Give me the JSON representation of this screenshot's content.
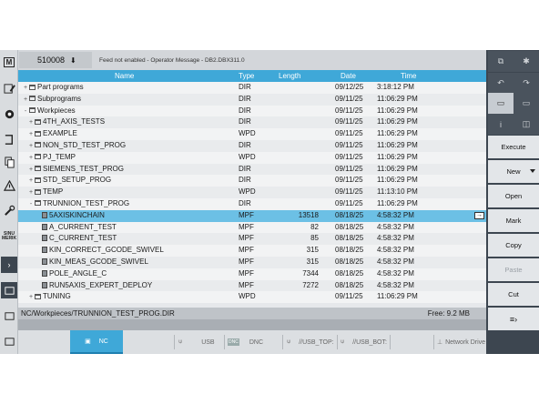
{
  "header": {
    "alarm_number": "510008",
    "alarm_text": "Feed not enabled - Operator Message -  DB2.DBX311.0"
  },
  "columns": {
    "name": "Name",
    "type": "Type",
    "length": "Length",
    "date": "Date",
    "time": "Time"
  },
  "rows": [
    {
      "expander": "+",
      "icon": "folder-icon",
      "name": "Part programs",
      "type": "DIR",
      "length": "",
      "date": "09/12/25",
      "time": "3:18:12 PM"
    },
    {
      "expander": "+",
      "icon": "folder-icon",
      "name": "Subprograms",
      "type": "DIR",
      "length": "",
      "date": "09/11/25",
      "time": "11:06:29 PM"
    },
    {
      "expander": "-",
      "icon": "folder-icon",
      "name": "Workpieces",
      "type": "DIR",
      "length": "",
      "date": "09/11/25",
      "time": "11:06:29 PM"
    },
    {
      "expander": "+",
      "icon": "folder-icon",
      "name": "4TH_AXIS_TESTS",
      "type": "DIR",
      "length": "",
      "date": "09/11/25",
      "time": "11:06:29 PM"
    },
    {
      "expander": "+",
      "icon": "folder-icon",
      "name": "EXAMPLE",
      "type": "WPD",
      "length": "",
      "date": "09/11/25",
      "time": "11:06:29 PM"
    },
    {
      "expander": "+",
      "icon": "folder-icon",
      "name": "NON_STD_TEST_PROG",
      "type": "DIR",
      "length": "",
      "date": "09/11/25",
      "time": "11:06:29 PM"
    },
    {
      "expander": "+",
      "icon": "folder-icon",
      "name": "PJ_TEMP",
      "type": "WPD",
      "length": "",
      "date": "09/11/25",
      "time": "11:06:29 PM"
    },
    {
      "expander": "+",
      "icon": "folder-icon",
      "name": "SIEMENS_TEST_PROG",
      "type": "DIR",
      "length": "",
      "date": "09/11/25",
      "time": "11:06:29 PM"
    },
    {
      "expander": "+",
      "icon": "folder-icon",
      "name": "STD_SETUP_PROG",
      "type": "DIR",
      "length": "",
      "date": "09/11/25",
      "time": "11:06:29 PM"
    },
    {
      "expander": "+",
      "icon": "folder-icon",
      "name": "TEMP",
      "type": "WPD",
      "length": "",
      "date": "09/11/25",
      "time": "11:13:10 PM"
    },
    {
      "expander": "-",
      "icon": "folder-icon",
      "name": "TRUNNION_TEST_PROG",
      "type": "DIR",
      "length": "",
      "date": "09/11/25",
      "time": "11:06:29 PM"
    },
    {
      "expander": "",
      "icon": "file-icon",
      "name": "5AXISKINCHAIN",
      "type": "MPF",
      "length": "13518",
      "date": "08/18/25",
      "time": "4:58:32 PM"
    },
    {
      "expander": "",
      "icon": "file-icon",
      "name": "A_CURRENT_TEST",
      "type": "MPF",
      "length": "82",
      "date": "08/18/25",
      "time": "4:58:32 PM"
    },
    {
      "expander": "",
      "icon": "file-icon",
      "name": "C_CURRENT_TEST",
      "type": "MPF",
      "length": "85",
      "date": "08/18/25",
      "time": "4:58:32 PM"
    },
    {
      "expander": "",
      "icon": "file-icon",
      "name": "KIN_CORRECT_GCODE_SWIVEL",
      "type": "MPF",
      "length": "315",
      "date": "08/18/25",
      "time": "4:58:32 PM"
    },
    {
      "expander": "",
      "icon": "file-icon",
      "name": "KIN_MEAS_GCODE_SWIVEL",
      "type": "MPF",
      "length": "315",
      "date": "08/18/25",
      "time": "4:58:32 PM"
    },
    {
      "expander": "",
      "icon": "file-icon",
      "name": "POLE_ANGLE_C",
      "type": "MPF",
      "length": "7344",
      "date": "08/18/25",
      "time": "4:58:32 PM"
    },
    {
      "expander": "",
      "icon": "file-icon",
      "name": "RUN5AXIS_EXPERT_DEPLOY",
      "type": "MPF",
      "length": "7272",
      "date": "08/18/25",
      "time": "4:58:32 PM"
    },
    {
      "expander": "+",
      "icon": "folder-icon",
      "name": "TUNING",
      "type": "WPD",
      "length": "",
      "date": "09/11/25",
      "time": "11:06:29 PM"
    }
  ],
  "selected_row": "5AXISKINCHAIN",
  "status": {
    "path": "NC/Workpieces/TRUNNION_TEST_PROG.DIR",
    "free": "Free: 9.2 MB"
  },
  "left_bar": {
    "logo": "M",
    "sinumerik_label": "SINU\nMERIK"
  },
  "devices": [
    {
      "label": "NC",
      "icon": "nc-drive-icon",
      "active": true
    },
    {
      "label": "USB",
      "icon": "usb-icon",
      "active": false
    },
    {
      "label": "DNC",
      "icon": "dnc-icon",
      "active": false
    },
    {
      "label": "//USB_TOP:",
      "icon": "usb-icon",
      "active": false
    },
    {
      "label": "//USB_BOT:",
      "icon": "usb-icon",
      "active": false
    },
    {
      "label": "Network Drive",
      "icon": "network-drive-icon",
      "active": false
    }
  ],
  "softkeys": {
    "execute": "Execute",
    "new": "New",
    "open": "Open",
    "mark": "Mark",
    "copy": "Copy",
    "paste": "Paste",
    "cut": "Cut"
  },
  "colors": {
    "accent": "#3fa8d8",
    "selection": "#6cc0e5",
    "softkey_panel": "#3d4650"
  }
}
